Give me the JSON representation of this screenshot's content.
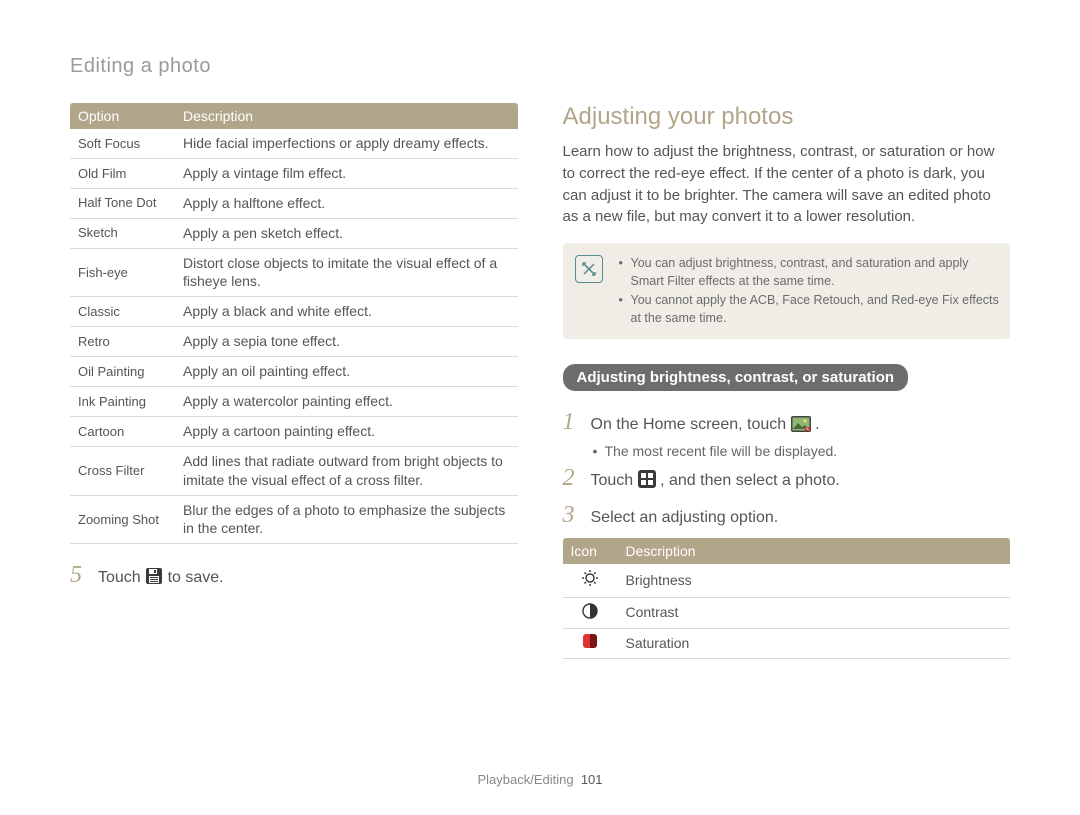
{
  "header": "Editing a photo",
  "options_table": {
    "headers": [
      "Option",
      "Description"
    ],
    "rows": [
      {
        "option": "Soft Focus",
        "desc": "Hide facial imperfections or apply dreamy effects."
      },
      {
        "option": "Old Film",
        "desc": "Apply a vintage film effect."
      },
      {
        "option": "Half Tone Dot",
        "desc": "Apply a halftone effect."
      },
      {
        "option": "Sketch",
        "desc": "Apply a pen sketch effect."
      },
      {
        "option": "Fish-eye",
        "desc": "Distort close objects to imitate the visual effect of a fisheye lens."
      },
      {
        "option": "Classic",
        "desc": "Apply a black and white effect."
      },
      {
        "option": "Retro",
        "desc": "Apply a sepia tone effect."
      },
      {
        "option": "Oil Painting",
        "desc": "Apply an oil painting effect."
      },
      {
        "option": "Ink Painting",
        "desc": "Apply a watercolor painting effect."
      },
      {
        "option": "Cartoon",
        "desc": "Apply a cartoon painting effect."
      },
      {
        "option": "Cross Filter",
        "desc": "Add lines that radiate outward from bright objects to imitate the visual effect of a cross filter."
      },
      {
        "option": "Zooming Shot",
        "desc": "Blur the edges of a photo to emphasize the subjects in the center."
      }
    ]
  },
  "left_steps": {
    "n5": "5",
    "s5_pre": "Touch ",
    "s5_post": " to save.",
    "save_icon_name": "save-disk-icon"
  },
  "right": {
    "title": "Adjusting your photos",
    "intro": "Learn how to adjust the brightness, contrast, or saturation or how to correct the red-eye effect. If the center of a photo is dark, you can adjust it to be brighter. The camera will save an edited photo as a new file, but may convert it to a lower resolution.",
    "note": [
      "You can adjust brightness, contrast, and saturation and apply Smart Filter effects at the same time.",
      "You cannot apply the ACB, Face Retouch, and Red-eye Fix effects at the same time."
    ],
    "pill": "Adjusting brightness, contrast, or saturation",
    "steps": {
      "n1": "1",
      "s1_pre": "On the Home screen, touch ",
      "s1_post": ".",
      "s1_sub": "The most recent file will be displayed.",
      "n2": "2",
      "s2_pre": "Touch ",
      "s2_post": ", and then select a photo.",
      "n3": "3",
      "s3": "Select an adjusting option."
    },
    "icon_table": {
      "headers": [
        "Icon",
        "Description"
      ],
      "rows": [
        {
          "icon": "brightness-icon",
          "desc": "Brightness"
        },
        {
          "icon": "contrast-icon",
          "desc": "Contrast"
        },
        {
          "icon": "saturation-icon",
          "desc": "Saturation"
        }
      ]
    }
  },
  "footer": {
    "section": "Playback/Editing",
    "page": "101"
  }
}
